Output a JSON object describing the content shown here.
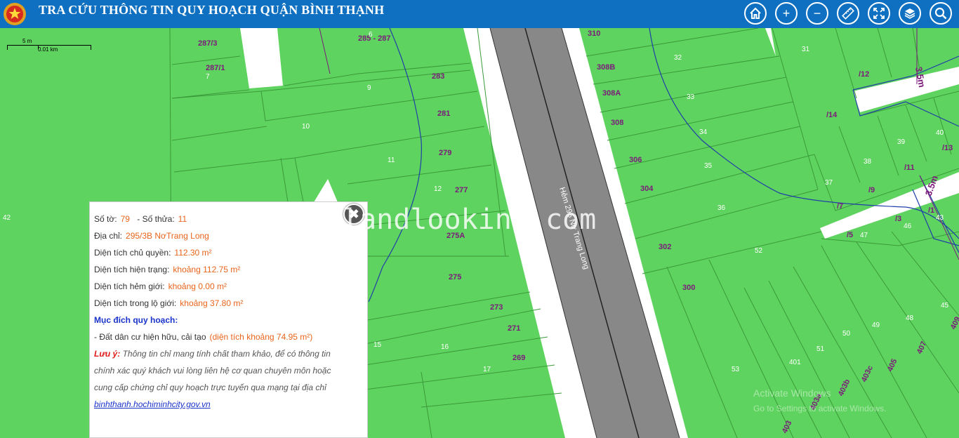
{
  "app": {
    "title": "TRA CỨU THÔNG TIN QUY HOẠCH QUẬN BÌNH THẠNH"
  },
  "toolbar": {
    "buttons": [
      {
        "icon": "home-icon"
      },
      {
        "icon": "zoom-in-icon",
        "glyph": "+"
      },
      {
        "icon": "zoom-out-icon",
        "glyph": "−"
      },
      {
        "icon": "ruler-icon"
      },
      {
        "icon": "fullscreen-icon"
      },
      {
        "icon": "layers-icon"
      },
      {
        "icon": "search-icon"
      }
    ]
  },
  "scale": {
    "small": "5 m",
    "large": "0.01 km"
  },
  "map": {
    "road_name": "Hẻm 295 Nơ Trang Long",
    "parcels_purple": [
      "287/3",
      "287/1",
      "285 - 287",
      "283",
      "281",
      "279",
      "277",
      "275A",
      "275",
      "273",
      "271",
      "269",
      "310",
      "308B",
      "308A",
      "308",
      "306",
      "304",
      "302",
      "300",
      "/12",
      "/14",
      "/9",
      "/7",
      "/5",
      "/11",
      "/13",
      "/3",
      "/1",
      "405",
      "407",
      "409",
      "403a",
      "403b",
      "403c",
      "403"
    ],
    "parcels_white": [
      "6",
      "7",
      "9",
      "10",
      "11",
      "12",
      "15",
      "16",
      "17",
      "42",
      "31",
      "32",
      "33",
      "34",
      "35",
      "36",
      "37",
      "38",
      "39",
      "40",
      "46",
      "47",
      "43",
      "45",
      "48",
      "49",
      "50",
      "51",
      "52",
      "53",
      "401"
    ],
    "dims": [
      "3.5m",
      "3.5m"
    ]
  },
  "popup": {
    "so_to_label": "Số tờ:",
    "so_to_value": "79",
    "so_thua_label": "- Số thửa:",
    "so_thua_value": "11",
    "dia_chi_label": "Địa chỉ:",
    "dia_chi_value": "295/3B NơTrang Long",
    "dt_chu_quyen_label": "Diện tích chủ quyền:",
    "dt_chu_quyen_value": "112.30 m²",
    "dt_hien_trang_label": "Diện tích hiện trạng:",
    "dt_hien_trang_value": "khoảng 112.75 m²",
    "dt_hem_gioi_label": "Diện tích hẻm giới:",
    "dt_hem_gioi_value": "khoảng 0.00 m²",
    "dt_lo_gioi_label": "Diện tích trong lộ giới:",
    "dt_lo_gioi_value": "khoảng 37.80 m²",
    "muc_dich_label": "Mục đích quy hoạch:",
    "dat_label": "- Đất dân cư hiện hữu, cải tạo",
    "dat_value": "(diện tích khoảng 74.95 m²)",
    "luu_y_label": "Lưu ý:",
    "note_line1": "Thông tin chỉ mang tính chất tham khảo, để có thông tin",
    "note_line2": "chính xác quý khách vui lòng liên hệ cơ quan chuyên môn hoặc",
    "note_line3": "cung cấp chứng chỉ quy hoạch trực tuyến qua mạng tại địa chỉ",
    "link": "binhthanh.hochiminhcity.gov.vn"
  },
  "watermark": "landlooking.com",
  "os": {
    "activate_title": "Activate Windows",
    "activate_sub": "Go to Settings to activate Windows."
  }
}
